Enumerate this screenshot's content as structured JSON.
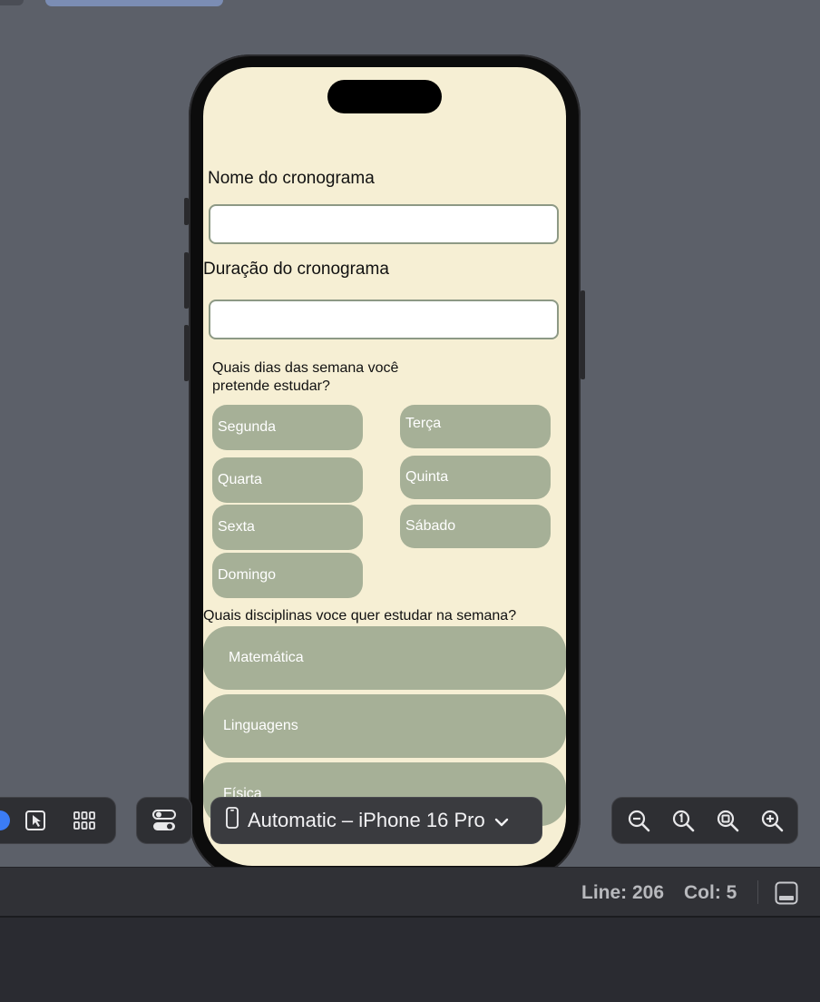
{
  "simulator": {
    "form": {
      "name_label": "Nome do cronograma",
      "name_value": "",
      "duration_label": "Duração do cronograma",
      "duration_value": "",
      "days_question": "Quais dias das semana você pretende estudar?",
      "days": [
        "Segunda",
        "Terça",
        "Quarta",
        "Quinta",
        "Sexta",
        "Sábado",
        "Domingo"
      ],
      "subjects_question": "Quais disciplinas voce quer estudar na semana?",
      "subjects": [
        "Matemática",
        "Linguagens",
        "Física"
      ]
    }
  },
  "canvas_toolbar": {
    "device_selector": "Automatic – iPhone 16 Pro",
    "icons": [
      "live-preview-icon",
      "selectable-preview-icon",
      "variants-grid-icon",
      "device-settings-icon",
      "zoom-out-icon",
      "actual-size-icon",
      "zoom-to-fit-icon",
      "zoom-in-icon"
    ]
  },
  "status": {
    "line": "Line: 206",
    "col": "Col: 5"
  },
  "colors": {
    "screen_bg": "#f6efd4",
    "chip_bg": "#a6b097",
    "canvas_bg": "#5c6069"
  }
}
